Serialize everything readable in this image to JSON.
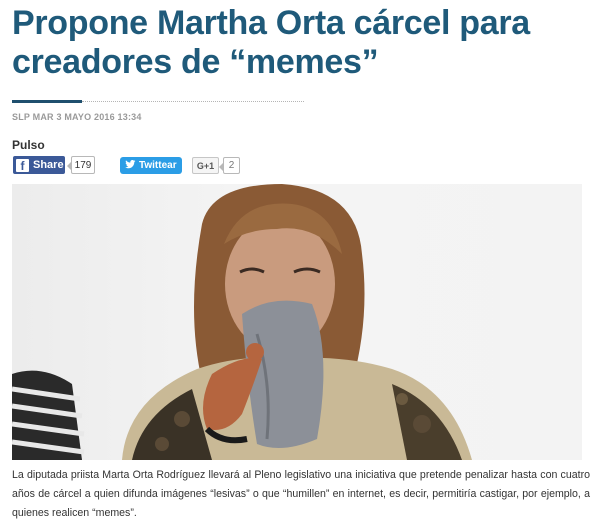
{
  "article": {
    "headline": "Propone Martha Orta cárcel para creadores de “memes”",
    "dateline": "SLP MAR 3 MAYO 2016 13:34",
    "section": "Pulso",
    "body": "La diputada priista Marta Orta Rodríguez llevará al Pleno legislativo una iniciativa que pretende penalizar hasta con cuatro años de cárcel a quien difunda imágenes “lesivas” o que “humillen” en internet, es decir, permitiría castigar, por ejemplo, a quienes realicen “memes”."
  },
  "share": {
    "facebook_label": "Share",
    "facebook_count": "179",
    "twitter_label": "Twittear",
    "gplus_label": "G+1",
    "gplus_count": "2"
  },
  "colors": {
    "headline": "#1f5a7a",
    "facebook": "#3b5998",
    "twitter": "#2b9de6"
  },
  "icons": {
    "facebook": "facebook-icon",
    "twitter": "twitter-bird-icon",
    "google_plus": "google-plus-icon"
  }
}
